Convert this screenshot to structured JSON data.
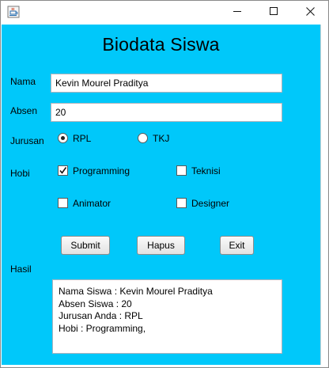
{
  "window": {
    "title": "",
    "controls": {
      "minimize": "minimize",
      "maximize": "maximize",
      "close": "close"
    }
  },
  "form": {
    "title": "Biodata Siswa",
    "nama_label": "Nama",
    "nama_value": "Kevin Mourel Praditya",
    "absen_label": "Absen",
    "absen_value": "20",
    "jurusan_label": "Jurusan",
    "jurusan_options": [
      {
        "label": "RPL",
        "selected": true
      },
      {
        "label": "TKJ",
        "selected": false
      }
    ],
    "hobi_label": "Hobi",
    "hobi_options": [
      {
        "label": "Programming",
        "checked": true
      },
      {
        "label": "Teknisi",
        "checked": false
      },
      {
        "label": "Animator",
        "checked": false
      },
      {
        "label": "Designer",
        "checked": false
      }
    ],
    "buttons": {
      "submit": "Submit",
      "hapus": "Hapus",
      "exit": "Exit"
    },
    "hasil_label": "Hasil",
    "hasil_lines": [
      "Nama Siswa : Kevin Mourel Praditya",
      "Absen Siswa : 20",
      "Jurusan Anda : RPL",
      "Hobi : Programming,"
    ]
  },
  "colors": {
    "panel_background": "#00c8fa",
    "window_background": "#ffffff"
  },
  "icons": {
    "app": "java-cup-icon",
    "minimize": "minimize-icon",
    "maximize": "maximize-icon",
    "close": "close-icon"
  }
}
